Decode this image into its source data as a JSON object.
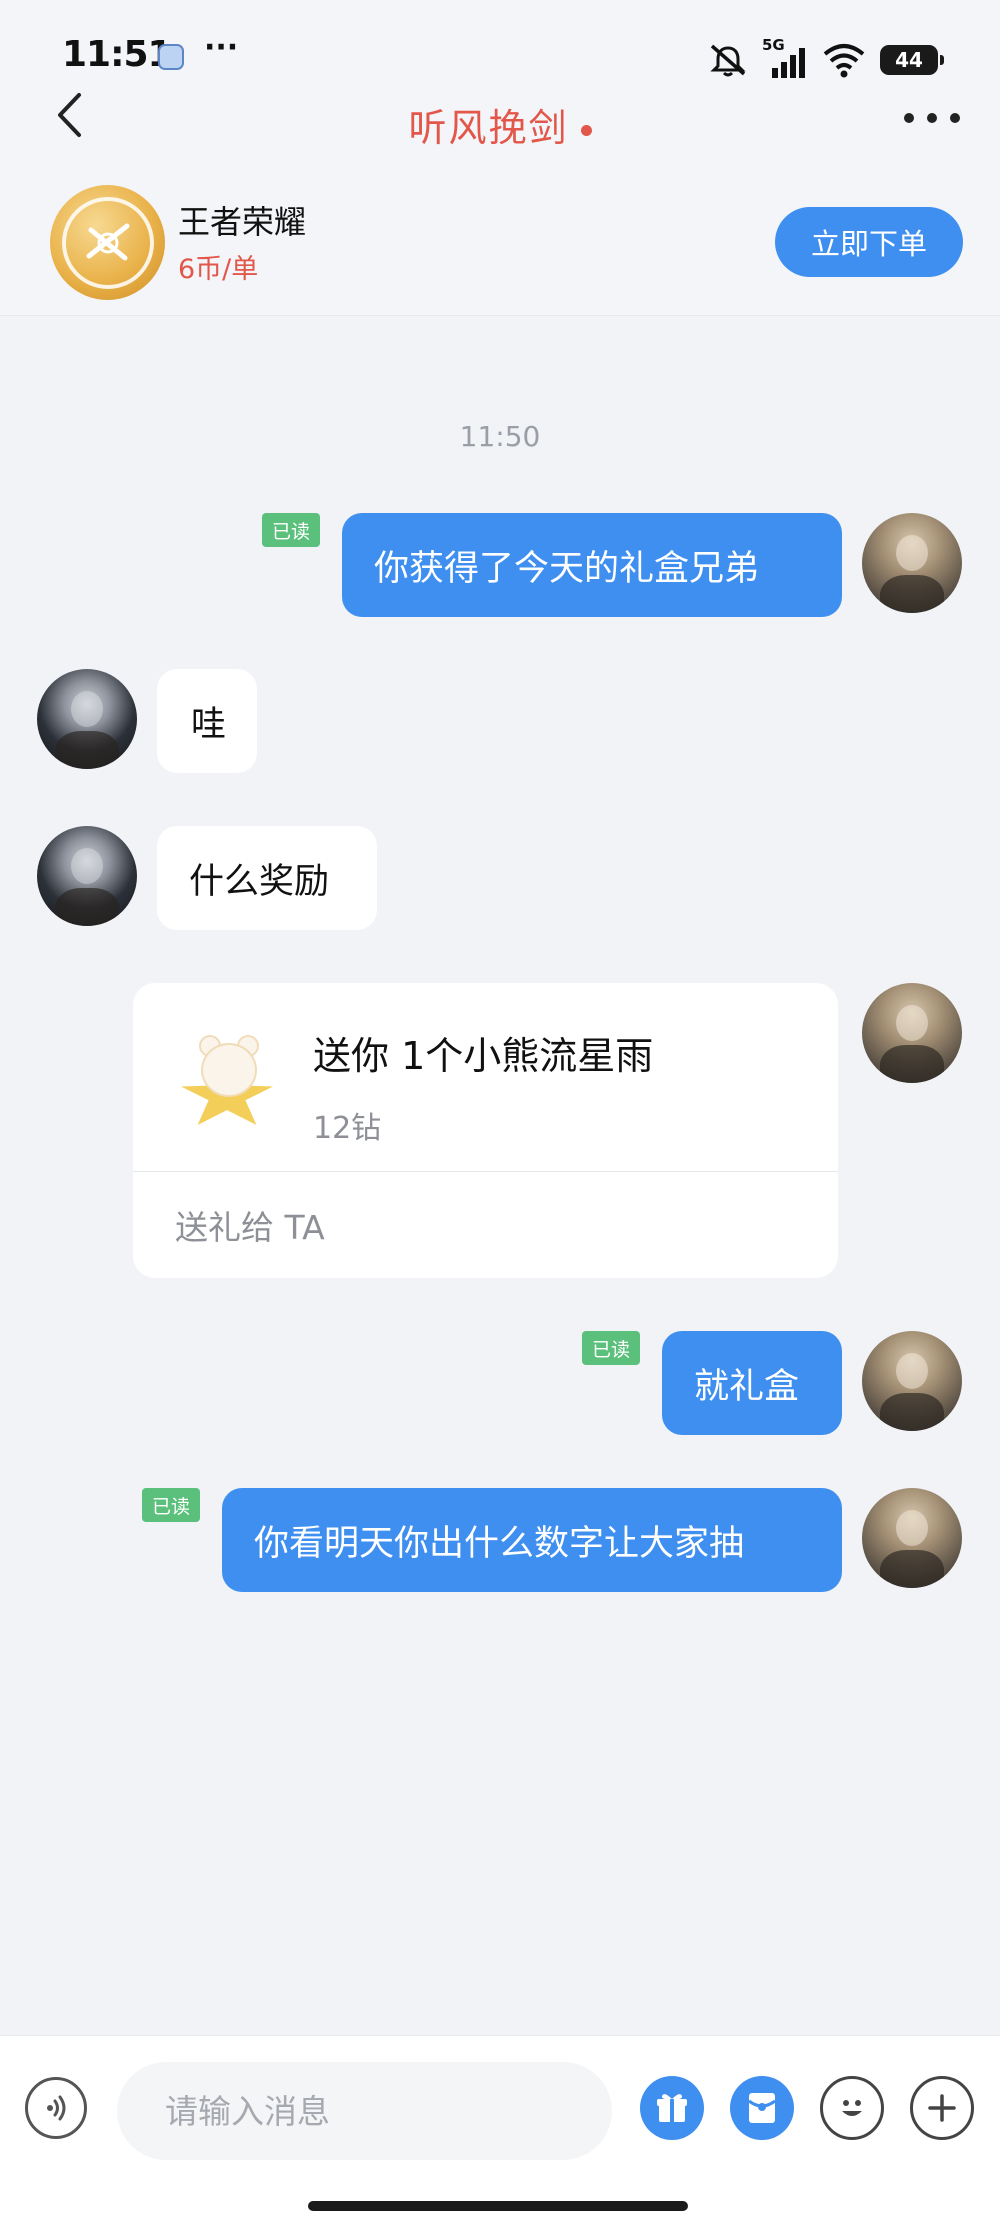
{
  "status_bar": {
    "time": "11:51",
    "dots": "···",
    "network": "5G",
    "battery": "44"
  },
  "nav": {
    "title": "听风挽剑",
    "title_color": "#e2574a"
  },
  "service": {
    "game_name": "王者荣耀",
    "price": "6币/单",
    "order_button": "立即下单",
    "accent": "#3f8ff0"
  },
  "chat": {
    "timestamp": "11:50",
    "read_tag": "已读",
    "messages": [
      {
        "from": "self",
        "text": "你获得了今天的礼盒兄弟",
        "read": true
      },
      {
        "from": "peer",
        "text": "哇"
      },
      {
        "from": "peer",
        "text": "什么奖励"
      },
      {
        "from": "self",
        "type": "gift",
        "title": "送你 1个小熊流星雨",
        "price": "12钻",
        "action": "送礼给 TA"
      },
      {
        "from": "self",
        "text": "就礼盒",
        "read": true
      },
      {
        "from": "self",
        "text": "你看明天你出什么数字让大家抽",
        "read": true
      }
    ]
  },
  "input": {
    "placeholder": "请输入消息",
    "icons": [
      "voice-icon",
      "gift-icon",
      "red-packet-icon",
      "emoji-icon",
      "plus-icon"
    ]
  }
}
